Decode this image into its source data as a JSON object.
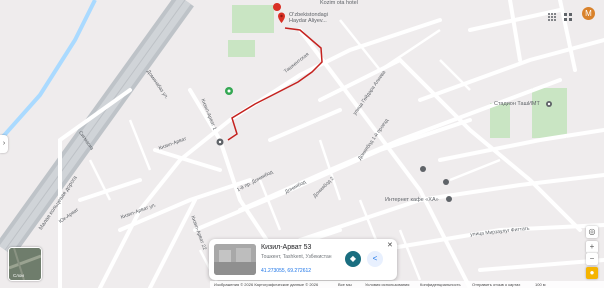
{
  "colors": {
    "road": "#ffffff",
    "background": "#efeced",
    "park": "#c9e5c3",
    "highway": "#bec3c8",
    "route": "#c5221f",
    "water": "#aadaff",
    "accent": "#1a6e80"
  },
  "top_poi_label": "Kozim ota hotel",
  "place_labels": {
    "main_pin": [
      "O'zbekistondagi",
      "Haydar Aliyev..."
    ],
    "stadium": "Стадион ТашИМТ",
    "internet_cafe": "Интернет кафе «ХА»"
  },
  "street_labels": {
    "highway": "Малая кольцевая дорога",
    "kizil_arvat": "Кизил-Арват",
    "kizil_arvat_upper": "Кизил-Арват 1",
    "kizil_arvat_ul": "Кизил-Арват ул.",
    "kizil_arvat_road": "Кизил-Арват",
    "yuk_arvat": "Юк-Арват",
    "kizil_arvat_22": "Кизил-Арват 22",
    "street_tnkuchtal": "1-й пр. Дониябод",
    "doniyobod": "Дониябод",
    "doniyobod_2": "Дониябод 2",
    "mira": "улица Гейдара Алиева",
    "tashkent": "Ташкентская",
    "markaz": "улица Мирзаулуг Фиттать",
    "kuyi": "Дониябод 1-й проезд",
    "sigma": "Сигмасиз",
    "dominant": "Доминабаз ул."
  },
  "card": {
    "title": "Кизил-Арват 53",
    "address": "Тошкент, Tashkent, Узбекистан",
    "coords": "41.273055, 69.272612",
    "close": "✕"
  },
  "layers": {
    "label": "Слои"
  },
  "avatar_letter": "M",
  "side_tab": "›",
  "controls": {
    "zoom_in": "+",
    "zoom_out": "−"
  },
  "footer": {
    "copyright": "Изображения © 2026 Картографические данные © 2026",
    "country": "Все мы",
    "terms": "Условия использования",
    "privacy": "Конфиденциальность",
    "feedback": "Отправить отзыв о картах",
    "scale": "100 м"
  }
}
